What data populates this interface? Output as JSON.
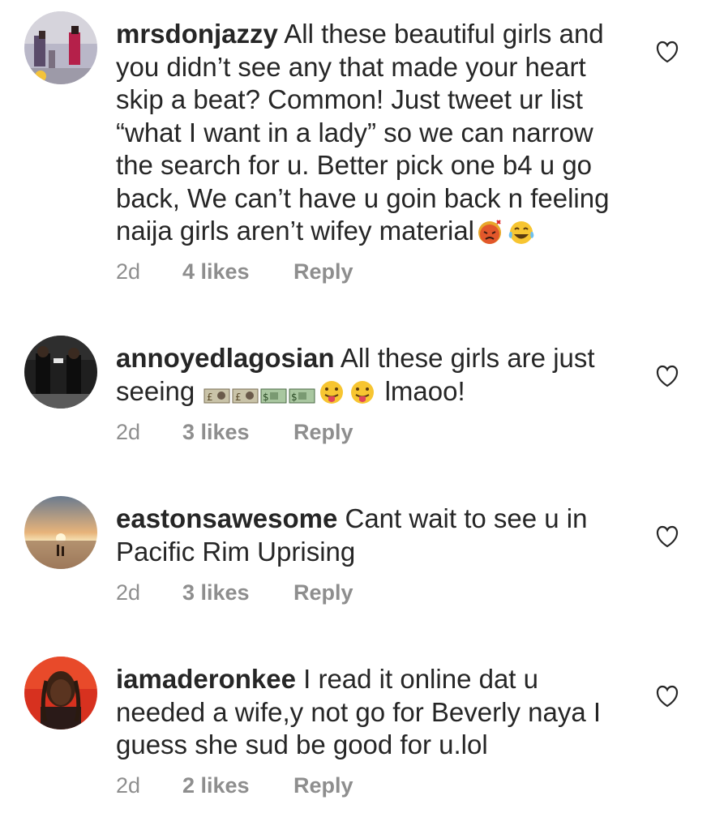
{
  "comments": [
    {
      "username": "mrsdonjazzy",
      "text": "All these beautiful girls and you didn’t see any that made your heart skip a beat? Common! Just tweet ur list “what I want in a lady” so we can narrow the search for u. Better pick one b4 u go back, We can’t have u goin back n feeling naija girls aren’t wifey material",
      "emojis": [
        "angry-face",
        "tears-of-joy"
      ],
      "time": "2d",
      "likes": "4 likes",
      "reply": "Reply"
    },
    {
      "username": "annoyedlagosian",
      "text": "All these girls are just seeing",
      "money_emojis": [
        "pound-banknote",
        "pound-banknote",
        "dollar-banknote",
        "dollar-banknote"
      ],
      "text_after": "lmaoo!",
      "time": "2d",
      "likes": "3 likes",
      "reply": "Reply"
    },
    {
      "username": "eastonsawesome",
      "text": "Cant wait to see u in Pacific Rim Uprising",
      "time": "2d",
      "likes": "3 likes",
      "reply": "Reply"
    },
    {
      "username": "iamaderonkee",
      "text": "I read it online dat u needed a wife,y not go for Beverly naya I guess she sud be good for u.lol",
      "time": "2d",
      "likes": "2 likes",
      "reply": "Reply"
    }
  ],
  "colors": {
    "text": "#262626",
    "meta": "#8e8e8e",
    "heart": "#262626"
  }
}
